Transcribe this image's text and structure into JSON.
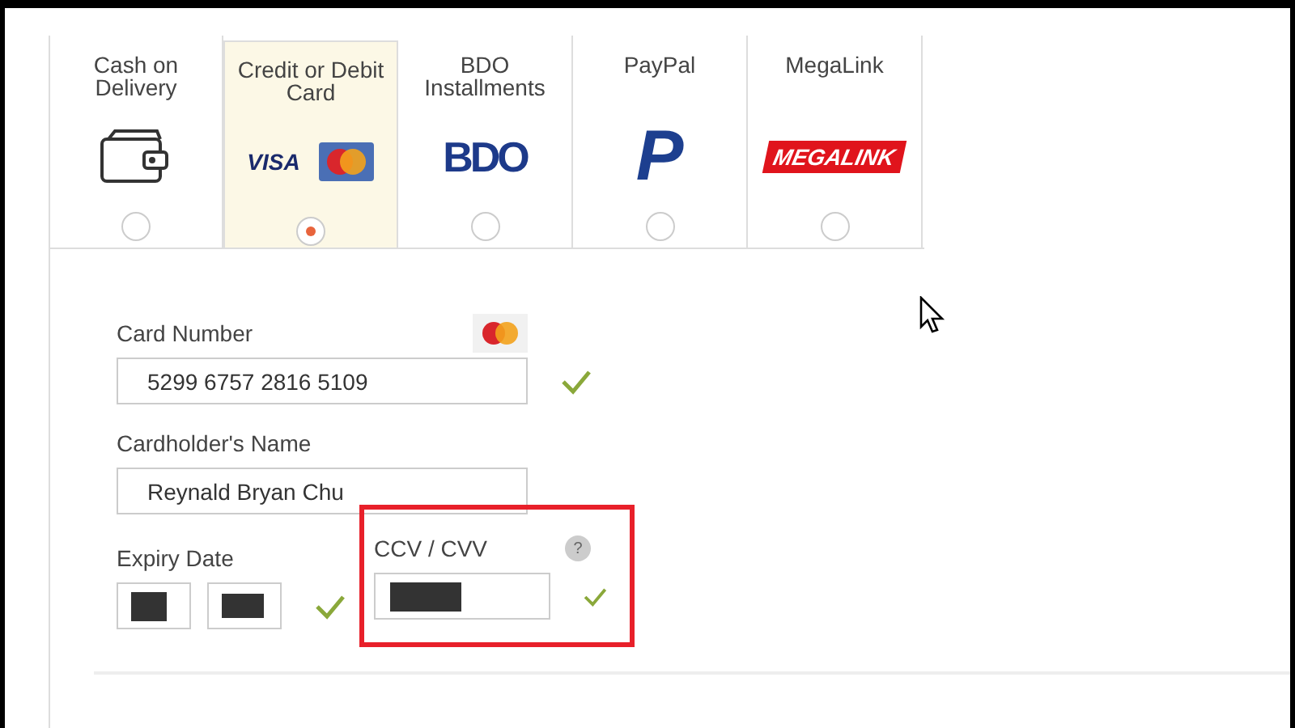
{
  "payment_methods": [
    {
      "label": "Cash on Delivery",
      "kind": "wallet",
      "selected": false
    },
    {
      "label": "Credit or Debit Card",
      "kind": "cards",
      "logo_text": "VISA",
      "selected": true
    },
    {
      "label": "BDO Installments",
      "kind": "bdo",
      "logo_text": "BDO",
      "selected": false
    },
    {
      "label": "PayPal",
      "kind": "paypal",
      "logo_text": "P",
      "selected": false
    },
    {
      "label": "MegaLink",
      "kind": "megalink",
      "logo_text": "MEGALINK",
      "selected": false
    }
  ],
  "card_number": {
    "label": "Card Number",
    "value": "5299 6757 2816 5109",
    "valid": true
  },
  "cardholder_name": {
    "label": "Cardholder's Name",
    "value": "Reynald Bryan Chu"
  },
  "expiry_date": {
    "label": "Expiry Date",
    "masked": true,
    "valid": true
  },
  "ccv": {
    "label": "CCV / CVV",
    "help": "?",
    "masked": true,
    "valid": true,
    "highlighted": true
  }
}
